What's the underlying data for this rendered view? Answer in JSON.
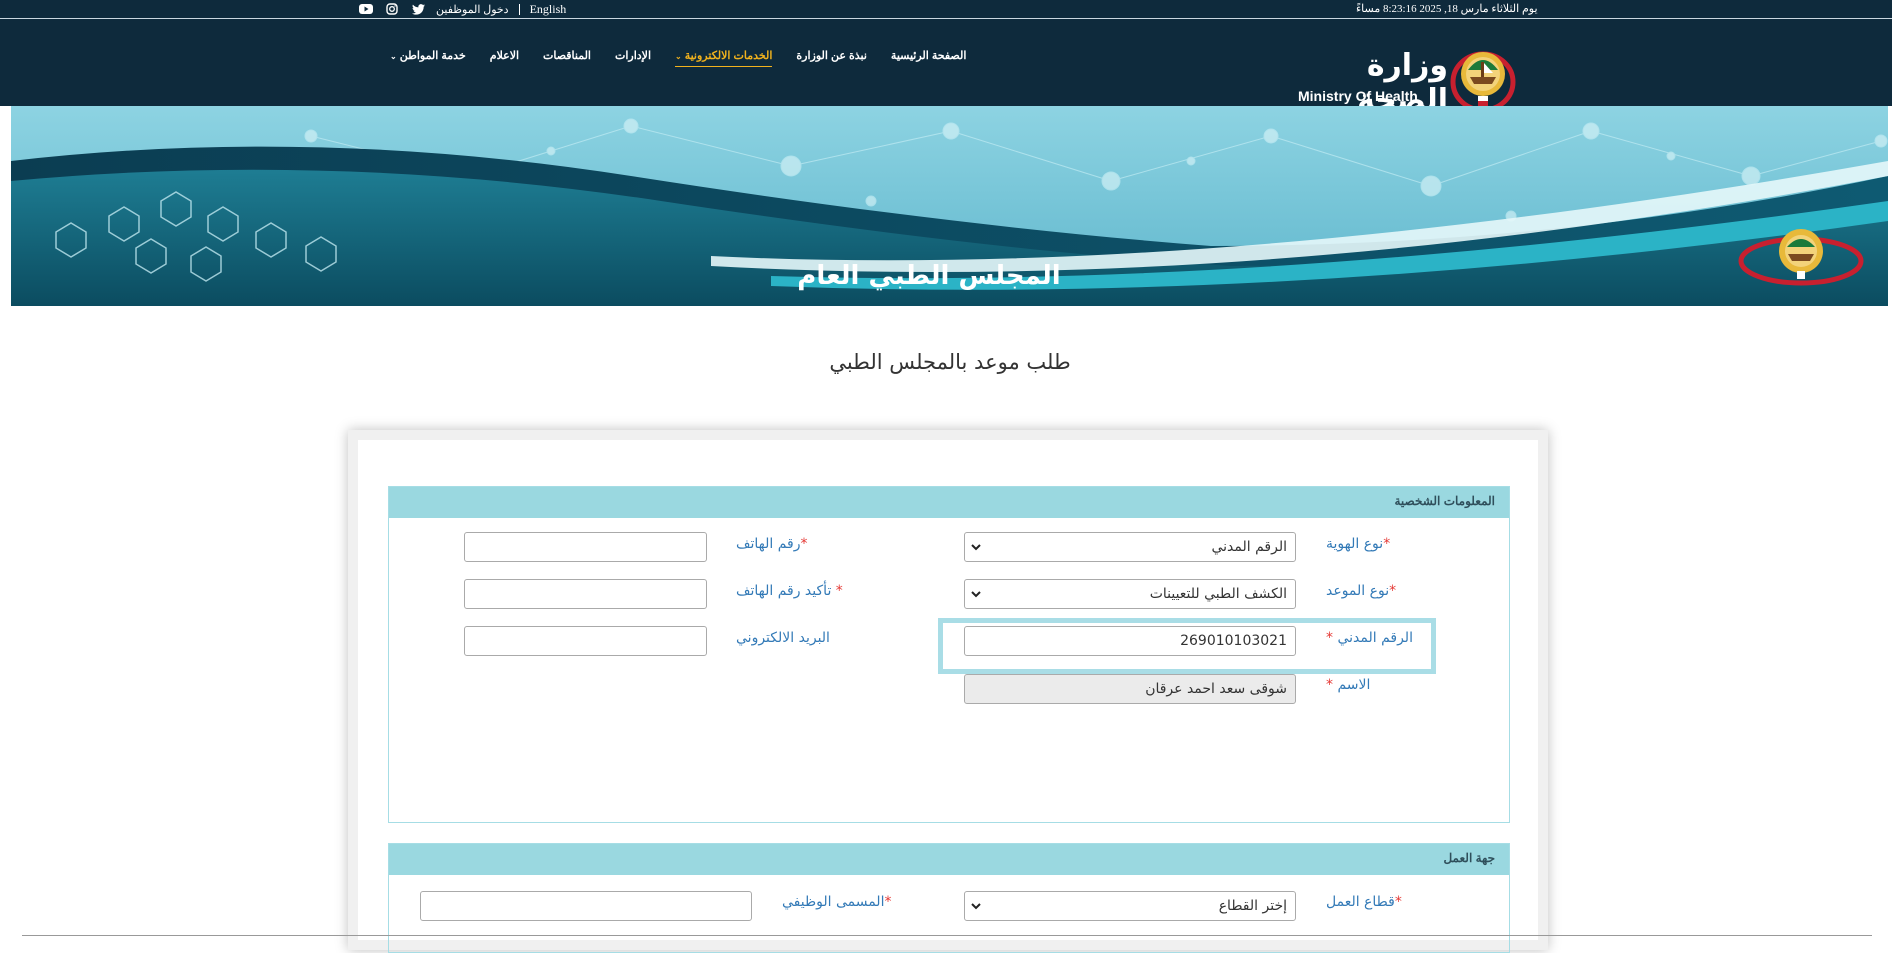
{
  "topbar": {
    "datetime": "يوم الثلاثاء مارس 18, 2025 8:23:16 مساءً",
    "english_label": "English",
    "employee_login": "دخول الموظفين",
    "social": [
      "twitter-icon",
      "instagram-icon",
      "youtube-icon"
    ]
  },
  "header": {
    "logo_ar": "وزارة الصحة",
    "logo_en": "Ministry Of Health",
    "nav": [
      {
        "label": "الصفحة الرئيسية",
        "active": false,
        "dropdown": false
      },
      {
        "label": "نبذة عن الوزارة",
        "active": false,
        "dropdown": false
      },
      {
        "label": "الخدمات الالكترونية",
        "active": true,
        "dropdown": true
      },
      {
        "label": "الإدارات",
        "active": false,
        "dropdown": false
      },
      {
        "label": "المناقصات",
        "active": false,
        "dropdown": false
      },
      {
        "label": "الاعلام",
        "active": false,
        "dropdown": false
      },
      {
        "label": "خدمة المواطن",
        "active": false,
        "dropdown": true
      }
    ],
    "active_color": "#f1b21d",
    "bg_color": "#0e2a3c"
  },
  "banner": {
    "title": "المجلس الطبي العام"
  },
  "page": {
    "title": "طلب موعد بالمجلس الطبي"
  },
  "personal": {
    "heading": "المعلومات الشخصية",
    "id_type_label": "نوع الهوية",
    "id_type_value": "الرقم المدني",
    "appt_type_label": "نوع الموعد",
    "appt_type_value": "الكشف الطبي للتعيينات",
    "civil_id_label": "الرقم المدني",
    "civil_id_value": "269010103021",
    "name_label": "الاسم",
    "name_value": "شوقى سعد احمد عرقان",
    "phone_label": "رقم الهاتف",
    "phone_value": "",
    "phone_confirm_label": "تأكيد رقم الهاتف",
    "phone_confirm_value": "",
    "email_label": "البريد الالكتروني",
    "email_value": ""
  },
  "work": {
    "heading": "جهة العمل",
    "sector_label": "قطاع العمل",
    "sector_value": "إختر القطاع",
    "job_title_label": "المسمى الوظيفي",
    "job_title_value": ""
  },
  "required_mark": "*"
}
